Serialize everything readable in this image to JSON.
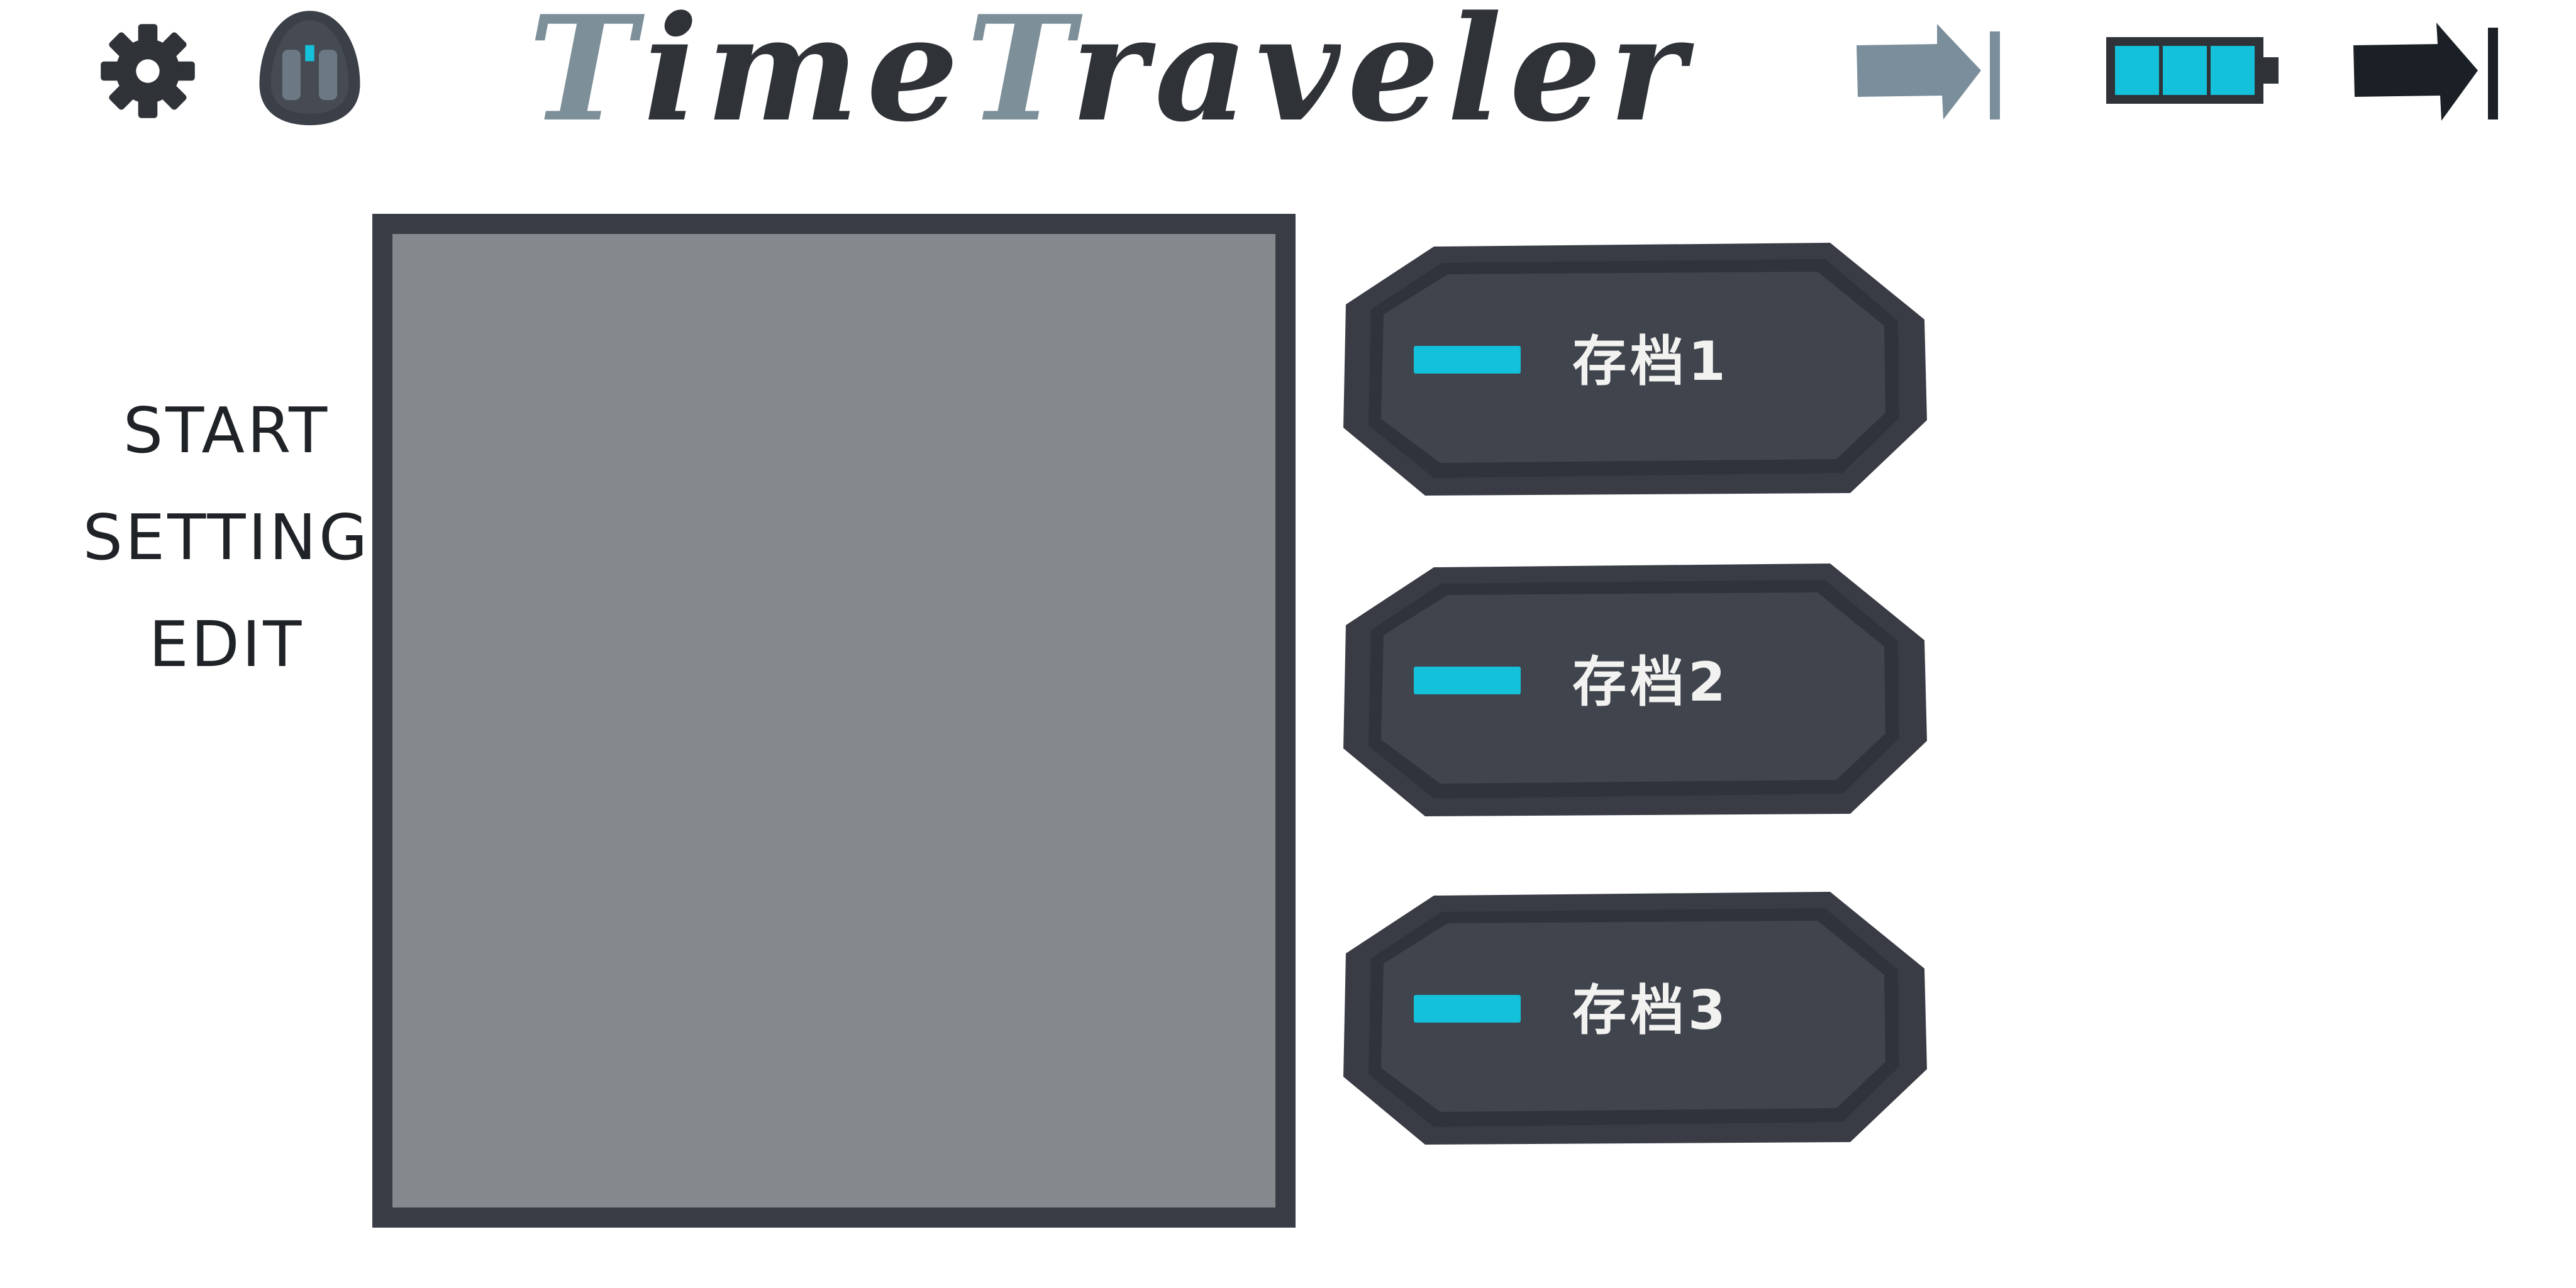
{
  "header": {
    "title_accent_1": "T",
    "title_part_1": "ime",
    "title_accent_2": "T",
    "title_part_2": "raveler",
    "settings_icon": "gear-icon",
    "character_icon": "helmet-icon",
    "skip_icon": "skip-forward-icon",
    "battery_icon": "battery-icon",
    "battery_level": 1.0,
    "exit_icon": "skip-to-end-icon"
  },
  "menu": {
    "items": [
      {
        "label": "START"
      },
      {
        "label": "SETTING"
      },
      {
        "label": "EDIT"
      }
    ]
  },
  "slots": [
    {
      "label": "存档1"
    },
    {
      "label": "存档2"
    },
    {
      "label": "存档3"
    }
  ],
  "colors": {
    "accent": "#14c1db",
    "panel_dark": "#393c45",
    "preview_fill": "#85888c",
    "title_accent": "#7d8f98",
    "title_text": "#2f3338"
  }
}
